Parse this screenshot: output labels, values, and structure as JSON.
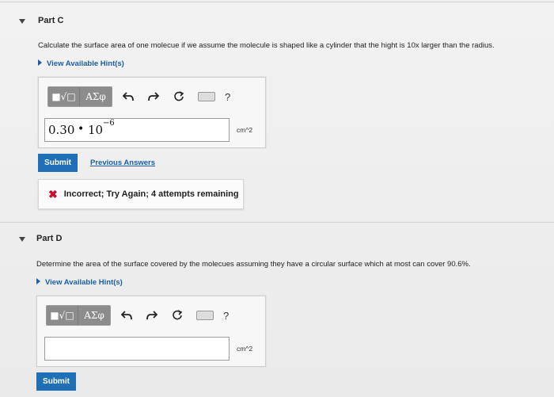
{
  "part_c": {
    "title": "Part C",
    "question": "Calculate the surface area of one molecue if we assume the molecule is shaped like a cylinder that the hight is 10x larger than the radius.",
    "hint_label": "View Available Hint(s)",
    "toolbar": {
      "templates_label": "■√□",
      "greek_label": "ΑΣφ",
      "help_label": "?"
    },
    "answer_mantissa": "0.30",
    "answer_dot": "•",
    "answer_base": "10",
    "answer_exponent": "−6",
    "unit": "cm^2",
    "submit_label": "Submit",
    "previous_answers_label": "Previous Answers",
    "feedback_text": "Incorrect; Try Again; 4 attempts remaining"
  },
  "part_d": {
    "title": "Part D",
    "question": "Determine the area of the surface covered by the molecues assuming they have a circular surface which at most can cover 90.6%.",
    "hint_label": "View Available Hint(s)",
    "toolbar": {
      "templates_label": "■√□",
      "greek_label": "ΑΣφ",
      "help_label": "?"
    },
    "answer_value": "",
    "unit": "cm^2",
    "submit_label": "Submit"
  },
  "colors": {
    "link": "#1a5fa8",
    "submit": "#1e6fb6",
    "error": "#c8102e"
  }
}
